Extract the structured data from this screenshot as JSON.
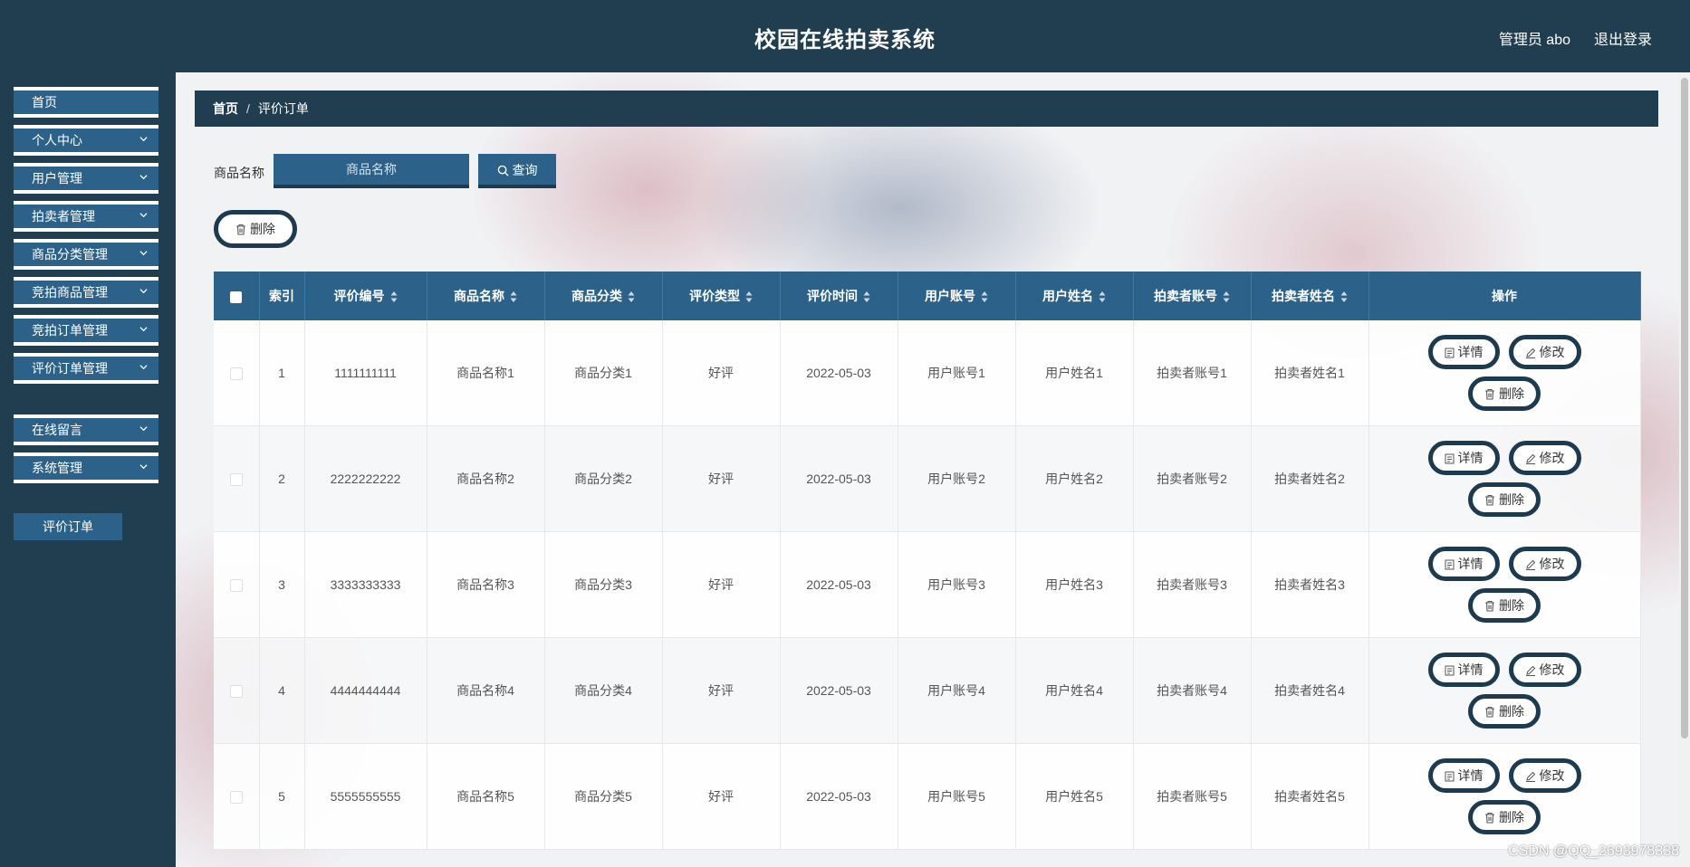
{
  "header": {
    "title": "校园在线拍卖系统",
    "user": "管理员 abo",
    "logout": "退出登录"
  },
  "sidebar": {
    "items": [
      {
        "label": "首页",
        "has_children": false
      },
      {
        "label": "个人中心",
        "has_children": true
      },
      {
        "label": "用户管理",
        "has_children": true
      },
      {
        "label": "拍卖者管理",
        "has_children": true
      },
      {
        "label": "商品分类管理",
        "has_children": true
      },
      {
        "label": "竞拍商品管理",
        "has_children": true
      },
      {
        "label": "竞拍订单管理",
        "has_children": true
      },
      {
        "label": "评价订单管理",
        "has_children": true
      },
      {
        "label": "在线留言",
        "has_children": true
      },
      {
        "label": "系统管理",
        "has_children": true
      }
    ],
    "active_sub": "评价订单"
  },
  "breadcrumb": {
    "home": "首页",
    "separator": "/",
    "current": "评价订单"
  },
  "search": {
    "label": "商品名称",
    "placeholder": "商品名称",
    "button": "查询"
  },
  "bulk_delete": "删除",
  "table": {
    "columns": [
      "索引",
      "评价编号",
      "商品名称",
      "商品分类",
      "评价类型",
      "评价时间",
      "用户账号",
      "用户姓名",
      "拍卖者账号",
      "拍卖者姓名",
      "操作"
    ],
    "rows": [
      {
        "index": "1",
        "code": "1111111111",
        "product": "商品名称1",
        "category": "商品分类1",
        "type": "好评",
        "time": "2022-05-03",
        "account": "用户账号1",
        "name": "用户姓名1",
        "seller_account": "拍卖者账号1",
        "seller_name": "拍卖者姓名1"
      },
      {
        "index": "2",
        "code": "2222222222",
        "product": "商品名称2",
        "category": "商品分类2",
        "type": "好评",
        "time": "2022-05-03",
        "account": "用户账号2",
        "name": "用户姓名2",
        "seller_account": "拍卖者账号2",
        "seller_name": "拍卖者姓名2"
      },
      {
        "index": "3",
        "code": "3333333333",
        "product": "商品名称3",
        "category": "商品分类3",
        "type": "好评",
        "time": "2022-05-03",
        "account": "用户账号3",
        "name": "用户姓名3",
        "seller_account": "拍卖者账号3",
        "seller_name": "拍卖者姓名3"
      },
      {
        "index": "4",
        "code": "4444444444",
        "product": "商品名称4",
        "category": "商品分类4",
        "type": "好评",
        "time": "2022-05-03",
        "account": "用户账号4",
        "name": "用户姓名4",
        "seller_account": "拍卖者账号4",
        "seller_name": "拍卖者姓名4"
      },
      {
        "index": "5",
        "code": "5555555555",
        "product": "商品名称5",
        "category": "商品分类5",
        "type": "好评",
        "time": "2022-05-03",
        "account": "用户账号5",
        "name": "用户姓名5",
        "seller_account": "拍卖者账号5",
        "seller_name": "拍卖者姓名5"
      }
    ],
    "actions": {
      "detail": "详情",
      "edit": "修改",
      "delete": "删除"
    }
  },
  "watermark": "CSDN @QQ_2693978338",
  "colors": {
    "header_bg": "#213d50",
    "accent": "#2c6189",
    "button_border": "#1d3b50"
  }
}
